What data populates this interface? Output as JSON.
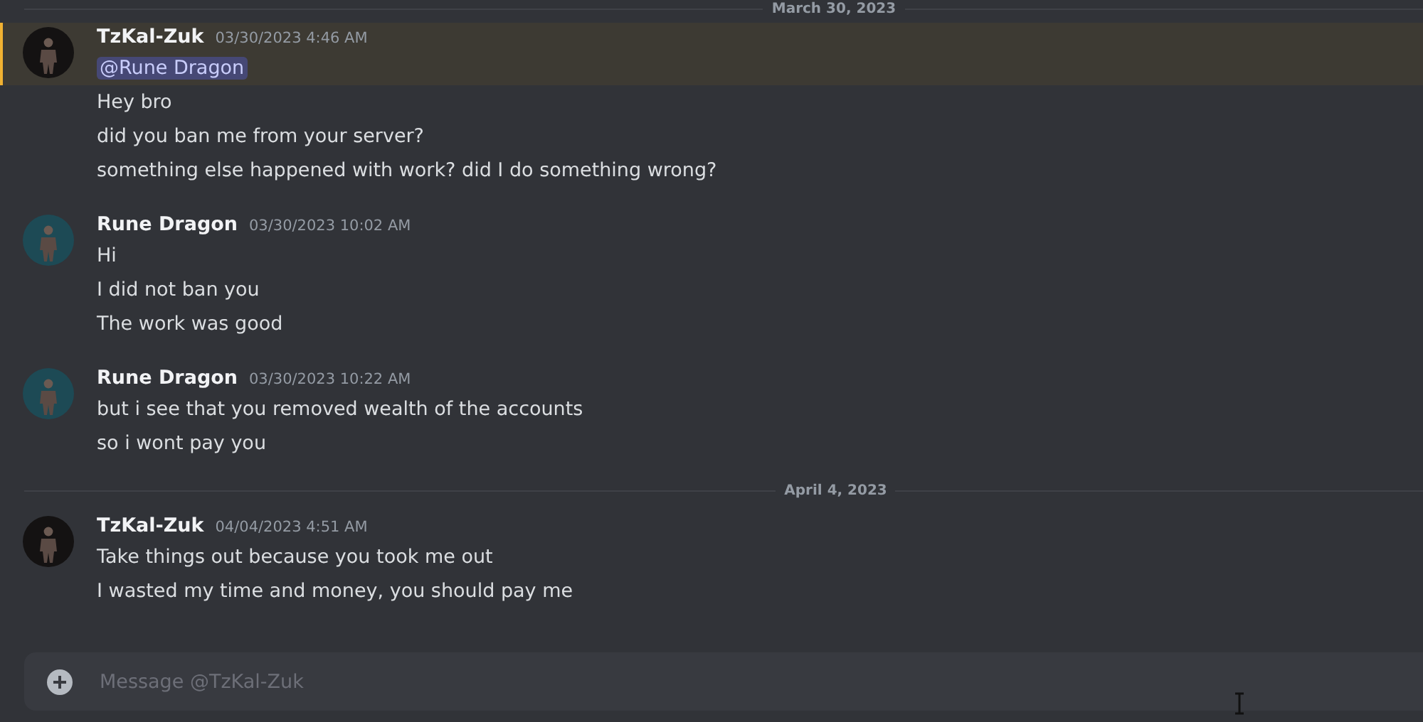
{
  "chat": [
    {
      "kind": "divider",
      "label": "March 30, 2023"
    },
    {
      "kind": "group",
      "author": "TzKal-Zuk",
      "timestamp": "03/30/2023 4:46 AM",
      "color": "#141212",
      "messages": [
        {
          "kind": "mention",
          "text": "@Rune Dragon",
          "highlighted": true
        },
        {
          "kind": "text",
          "text": "Hey bro",
          "highlighted": false
        },
        {
          "kind": "text",
          "text": "did you ban me from your server?",
          "highlighted": false
        },
        {
          "kind": "text",
          "text": "something else happened with work? did I do something wrong?",
          "highlighted": false
        }
      ]
    },
    {
      "kind": "group",
      "author": "Rune Dragon",
      "timestamp": "03/30/2023 10:02 AM",
      "color": "#1d4a55",
      "messages": [
        {
          "kind": "text",
          "text": "Hi",
          "highlighted": false
        },
        {
          "kind": "text",
          "text": "I did not ban you",
          "highlighted": false
        },
        {
          "kind": "text",
          "text": "The work was good",
          "highlighted": false
        }
      ]
    },
    {
      "kind": "group",
      "author": "Rune Dragon",
      "timestamp": "03/30/2023 10:22 AM",
      "color": "#1d4a55",
      "messages": [
        {
          "kind": "text",
          "text": "but i see that you removed wealth of the accounts",
          "highlighted": false
        },
        {
          "kind": "text",
          "text": "so i wont pay you",
          "highlighted": false
        }
      ]
    },
    {
      "kind": "divider",
      "label": "April 4, 2023"
    },
    {
      "kind": "group",
      "author": "TzKal-Zuk",
      "timestamp": "04/04/2023 4:51 AM",
      "color": "#141212",
      "messages": [
        {
          "kind": "text",
          "text": "Take things out because you took me out",
          "highlighted": false
        },
        {
          "kind": "text",
          "text": "I wasted my time and money, you should pay me",
          "highlighted": false
        }
      ]
    }
  ],
  "composer": {
    "placeholder": "Message @TzKal-Zuk"
  }
}
